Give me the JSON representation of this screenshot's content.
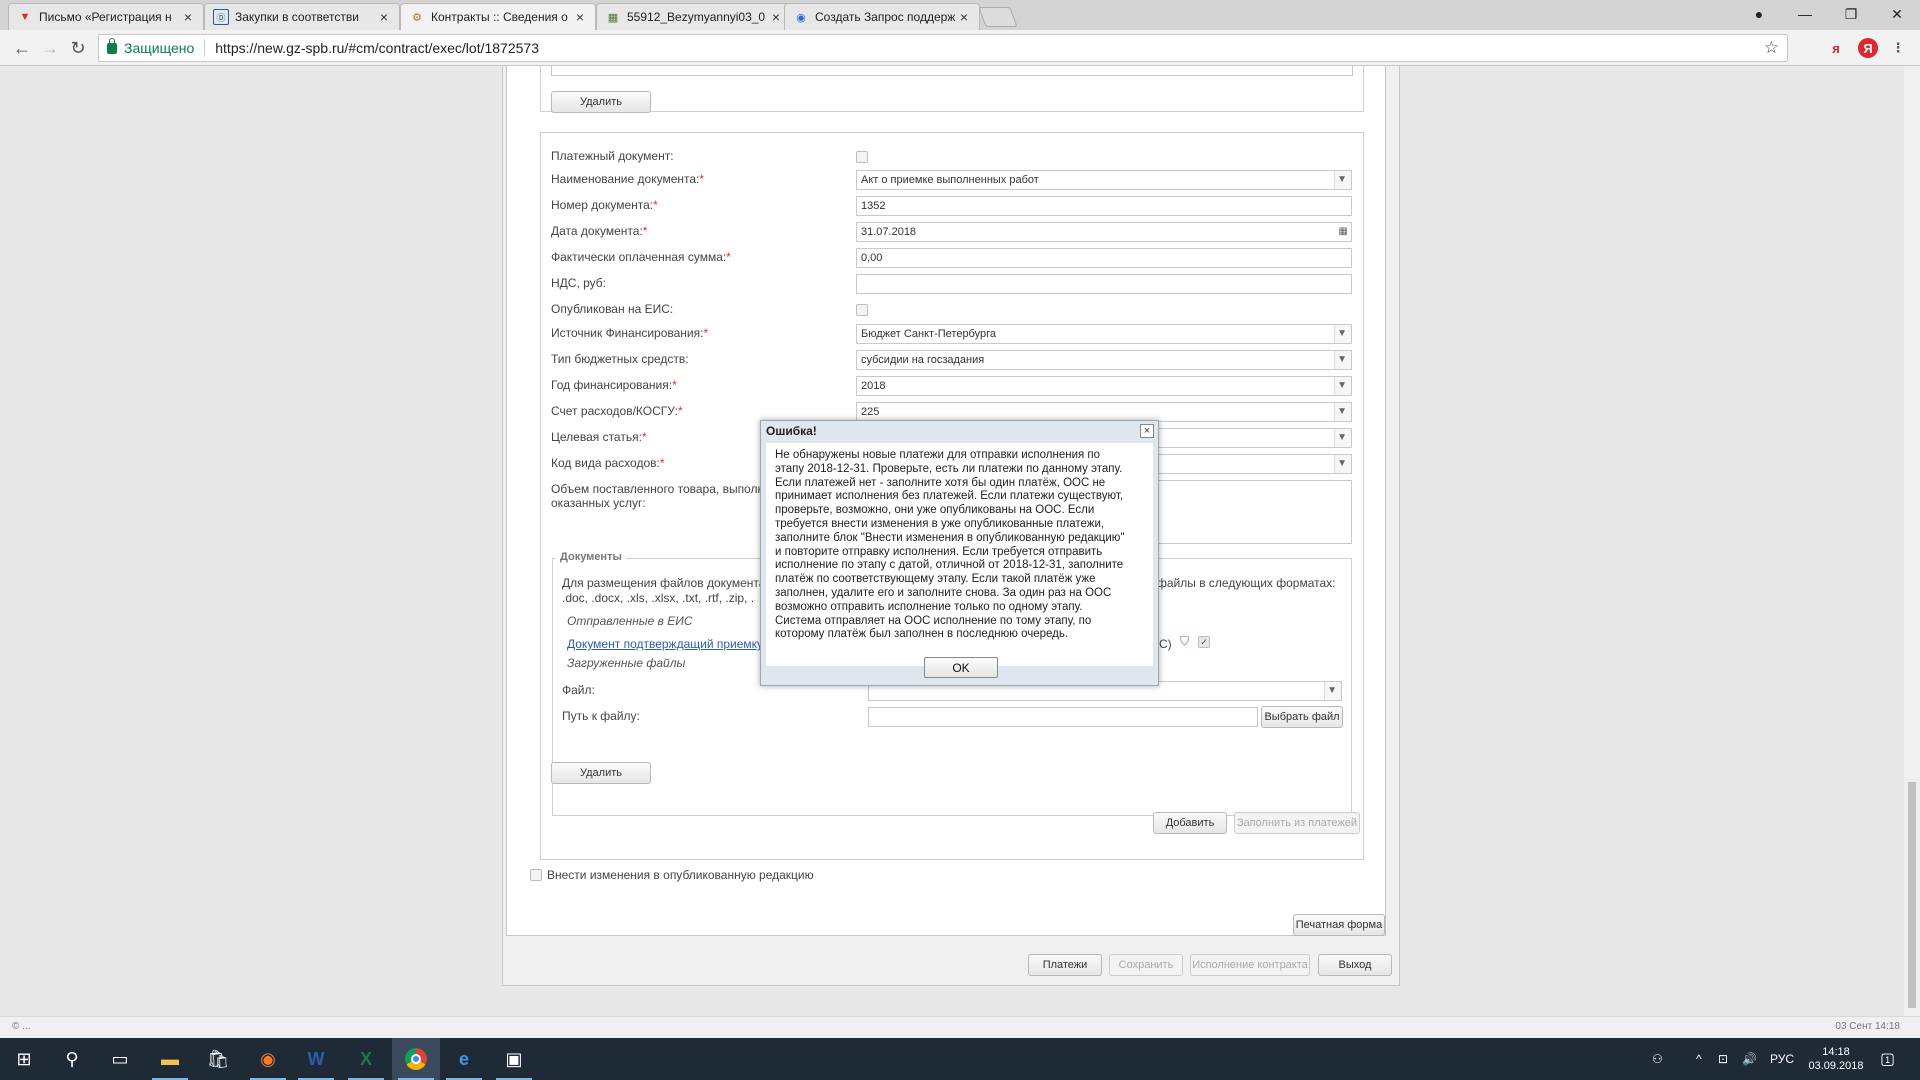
{
  "browser": {
    "tabs": [
      {
        "title": "Письмо «Регистрация н",
        "favicon": "mail-icon",
        "color": "#d93025"
      },
      {
        "title": "Закупки в соответстви",
        "favicon": "zakupki-icon",
        "color": "#1a5fa8"
      },
      {
        "title": "Контракты :: Сведения о",
        "favicon": "contracts-icon",
        "color": "#d06a20"
      },
      {
        "title": "55912_Bezymyannyi03_0",
        "favicon": "image-icon",
        "color": "#4a7a3a"
      },
      {
        "title": "Создать Запрос поддерж",
        "favicon": "support-icon",
        "color": "#1e6fd9"
      }
    ],
    "active_tab": 2,
    "secure_label": "Защищено",
    "url": "https://new.gz-spb.ru/#cm/contract/exec/lot/1872573",
    "ext_ya1": "я",
    "ext_ya2": "Я"
  },
  "form": {
    "delete_label": "Удалить",
    "payment_doc_label": "Платежный документ:",
    "doc_name_label": "Наименование документа:",
    "doc_name_value": "Акт о приемке выполненных работ",
    "doc_number_label": "Номер документа:",
    "doc_number_value": "1352",
    "doc_date_label": "Дата документа:",
    "doc_date_value": "31.07.2018",
    "paid_sum_label": "Фактически оплаченная сумма:",
    "paid_sum_value": "0,00",
    "vat_label": "НДС, руб:",
    "vat_value": "",
    "published_label": "Опубликован на ЕИС:",
    "funding_source_label": "Источник Финансирования:",
    "funding_source_value": "Бюджет Санкт-Петербурга",
    "budget_type_label": "Тип бюджетных средств:",
    "budget_type_value": "субсидии на госзадания",
    "funding_year_label": "Год финансирования:",
    "funding_year_value": "2018",
    "expense_account_label": "Счет расходов/КОСГУ:",
    "expense_account_value": "225",
    "target_article_label": "Целевая статья:",
    "expense_code_label": "Код вида расходов:",
    "volume_label_1": "Объем поставленного товара, выполн",
    "volume_label_2": "оказанных услуг:",
    "documents_legend": "Документы",
    "docs_hint_1_left": "Для размещения файлов документа",
    "docs_hint_1_right": "файлы в следующих форматах:",
    "docs_hint_2": ".doc, .docx, .xls, .xlsx, .txt, .rtf, .zip, .",
    "sent_eis": "Отправленные в ЕИС",
    "doc_link": "Документ подтверждащий приемку",
    "doc_link_suffix": "С)",
    "uploaded_files": "Загруженные файлы",
    "file_label": "Файл:",
    "file_path_label": "Путь к файлу:",
    "choose_file": "Выбрать файл",
    "delete2_label": "Удалить",
    "add_label": "Добавить",
    "fill_from_payments": "Заполнить из платежей",
    "amend_label": "Внести изменения в опубликованную редакцию",
    "print_form": "Печатная форма",
    "payments_btn": "Платежи",
    "save_btn": "Сохранить",
    "exec_btn": "Исполнение контракта",
    "exit_btn": "Выход"
  },
  "modal": {
    "title": "Ошибка!",
    "lines": [
      "Не обнаружены новые платежи для отправки исполнения по",
      "этапу 2018-12-31. Проверьте, есть ли платежи по данному этапу.",
      "Если платежей нет - заполните хотя бы один платёж, ООС не",
      "принимает исполнения без платежей. Если платежи существуют,",
      "проверьте, возможно, они уже опубликованы на ООС. Если",
      "требуется внести изменения в уже опубликованные платежи,",
      "заполните блок \"Внести изменения в опубликованную редакцию\"",
      "и повторите отправку исполнения. Если требуется отправить",
      "исполнение по этапу с датой, отличной от 2018-12-31, заполните",
      "платёж по соответствующему этапу. Если такой платёж уже",
      "заполнен, удалите его и заполните снова. За один раз на ООС",
      "возможно отправить исполнение только по одному этапу.",
      "Система отправляет на ООС исполнение по тому этапу, по",
      "которому платёж был заполнен в последнюю очередь."
    ],
    "ok": "OK"
  },
  "statusbar": {
    "left": "© ...",
    "right": "03 Сент 14:18"
  },
  "taskbar": {
    "lang": "РУС",
    "time": "14:18",
    "date": "03.09.2018",
    "notif_count": "1"
  }
}
